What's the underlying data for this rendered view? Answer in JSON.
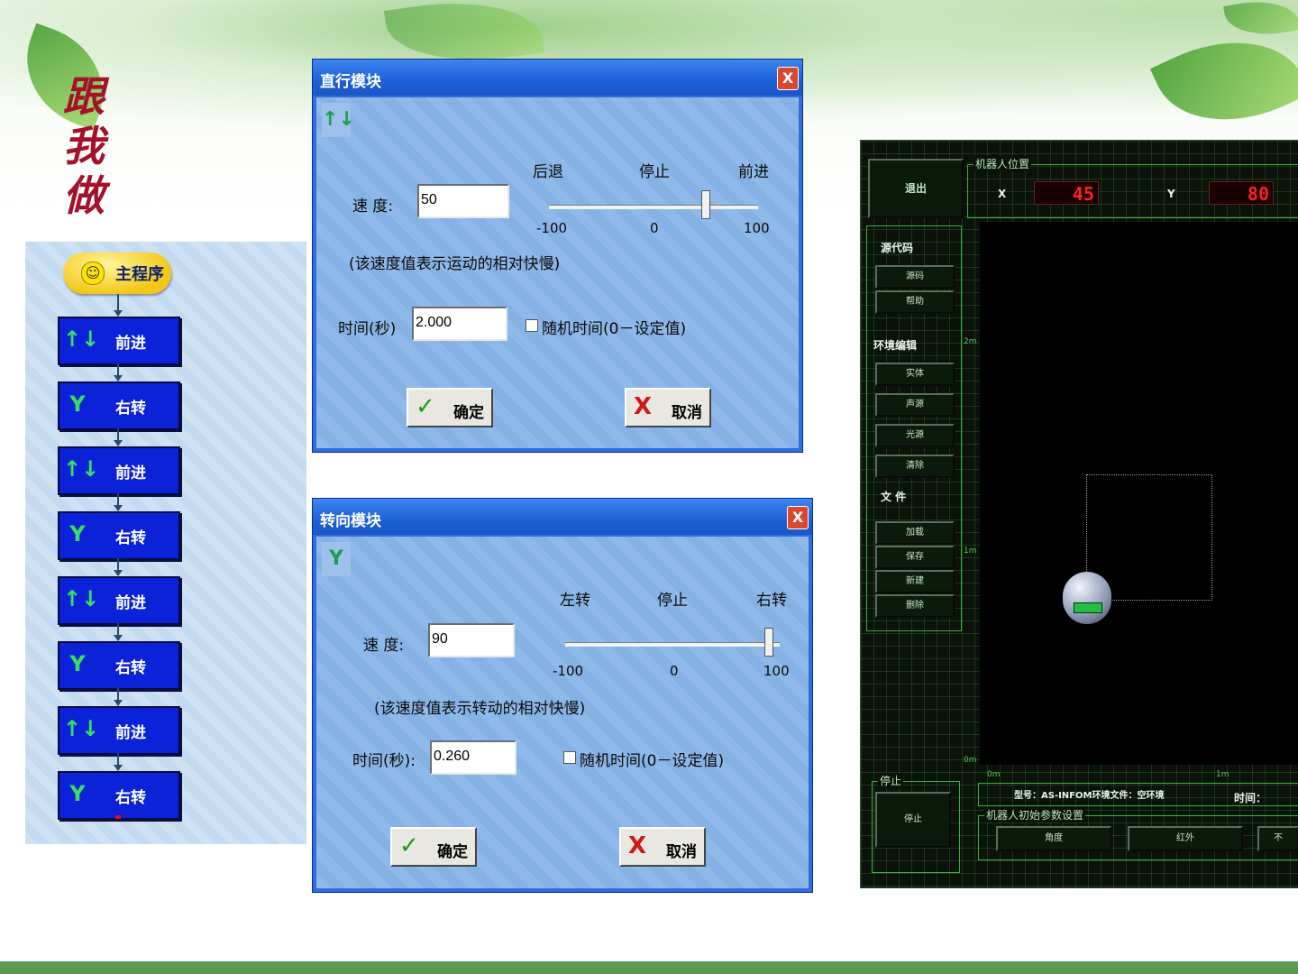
{
  "slide": {
    "title_chars": [
      "跟",
      "我",
      "做"
    ]
  },
  "flow": {
    "main_label": "主程序",
    "blocks": [
      {
        "icon": "↑↓",
        "label": "前进"
      },
      {
        "icon": "Y",
        "label": "右转"
      },
      {
        "icon": "↑↓",
        "label": "前进"
      },
      {
        "icon": "Y",
        "label": "右转"
      },
      {
        "icon": "↑↓",
        "label": "前进"
      },
      {
        "icon": "Y",
        "label": "右转"
      },
      {
        "icon": "↑↓",
        "label": "前进"
      },
      {
        "icon": "Y",
        "label": "右转"
      }
    ]
  },
  "straight_dialog": {
    "title": "直行模块",
    "close": "X",
    "icon": "↑↓",
    "dir_back": "后退",
    "dir_stop": "停止",
    "dir_forward": "前进",
    "speed_label": "速 度:",
    "speed_value": "50",
    "slider_min": "-100",
    "slider_mid": "0",
    "slider_max": "100",
    "slider_fraction": 0.75,
    "note": "(该速度值表示运动的相对快慢)",
    "time_label": "时间(秒)",
    "time_value": "2.000",
    "random_label": "随机时间(0－设定值)",
    "ok_icon": "✓",
    "ok_label": "确定",
    "cancel_icon": "X",
    "cancel_label": "取消"
  },
  "turn_dialog": {
    "title": "转向模块",
    "close": "X",
    "icon": "Y",
    "dir_left": "左转",
    "dir_stop": "停止",
    "dir_right": "右转",
    "speed_label": "速 度:",
    "speed_value": "90",
    "slider_min": "-100",
    "slider_mid": "0",
    "slider_max": "100",
    "slider_fraction": 0.95,
    "note": "(该速度值表示转动的相对快慢)",
    "time_label": "时间(秒):",
    "time_value": "0.260",
    "random_label": "随机时间(0－设定值)",
    "ok_icon": "✓",
    "ok_label": "确定",
    "cancel_icon": "X",
    "cancel_label": "取消"
  },
  "simulator": {
    "exit": "退出",
    "position_caption": "机器人位置",
    "x_label": "X",
    "x_value": "45",
    "y_label": "Y",
    "y_value": "80",
    "source_section": "源代码",
    "btn_source": "源码",
    "btn_help": "帮助",
    "env_section": "环境编辑",
    "btn_solid": "实体",
    "btn_sound": "声源",
    "btn_light": "光源",
    "btn_clear": "清除",
    "file_section": "文 件",
    "btn_load": "加载",
    "btn_save": "保存",
    "btn_new": "新建",
    "btn_delete": "删除",
    "stop_caption": "停止",
    "btn_stop": "停止",
    "scale_2m": "2m",
    "scale_1m": "1m",
    "scale_0m": "0m",
    "scale_x0": "0m",
    "scale_x1": "1m",
    "status_text": "型号：AS-INFOM环境文件：空环境",
    "time_label": "时间：",
    "init_caption": "机器人初始参数设置",
    "btn_angle": "角度",
    "btn_infrared": "红外",
    "btn_cut": "不"
  },
  "colors": {
    "title_red": "#a3122a",
    "block_blue": "#0b22d8",
    "dialog_blue": "#2f6de0",
    "led_red": "#ff2020",
    "grid_green": "#3bb13b"
  }
}
